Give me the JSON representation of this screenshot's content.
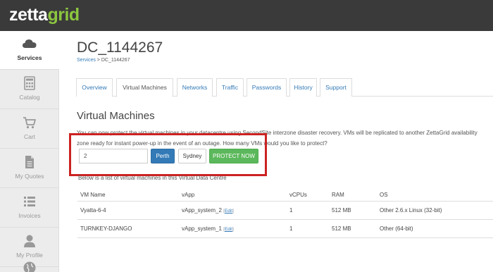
{
  "brand": {
    "part1": "zetta",
    "part2": "grid",
    "color_white": "#ffffff",
    "color_green": "#8cc63f"
  },
  "sidebar": {
    "items": [
      {
        "label": "Services",
        "icon": "cloud-icon",
        "active": true
      },
      {
        "label": "Catalog",
        "icon": "calculator-icon"
      },
      {
        "label": "Cart",
        "icon": "cart-icon"
      },
      {
        "label": "My Quotes",
        "icon": "document-icon"
      },
      {
        "label": "Invoices",
        "icon": "list-icon"
      },
      {
        "label": "My Profile",
        "icon": "user-icon"
      },
      {
        "label": "",
        "icon": "globe-icon"
      }
    ]
  },
  "page": {
    "title": "DC_1144267",
    "breadcrumb": {
      "root": "Services",
      "separator": ">",
      "current": "DC_1144267"
    }
  },
  "tabs": [
    "Overview",
    "Virtual Machines",
    "Networks",
    "Traffic",
    "Passwords",
    "History",
    "Support"
  ],
  "active_tab": "Virtual Machines",
  "section": {
    "title": "Virtual Machines",
    "description": "You can now protect the virtual machines in your datacentre using SecondSite interzone disaster recovery. VMs will be replicated to another ZettaGrid availability zone ready for instant power-up in the event of an outage. How many VMs would you like to protect?"
  },
  "protect_form": {
    "vm_count_value": "2",
    "perth_label": "Perth",
    "sydney_label": "Sydney",
    "protect_label": "PROTECT NOW"
  },
  "list_intro": "Below is a list of virtual machines in this Virtual Data Centre",
  "table": {
    "columns": [
      "VM Name",
      "vApp",
      "vCPUs",
      "RAM",
      "OS"
    ],
    "edit_label": "Edit",
    "rows": [
      {
        "name": "Vyatta-6-4",
        "vapp": "vApp_system_2",
        "vcpus": "1",
        "ram": "512 MB",
        "os": "Other 2.6.x Linux (32-bit)"
      },
      {
        "name": "TURNKEY-DJANGO",
        "vapp": "vApp_system_1",
        "vcpus": "1",
        "ram": "512 MB",
        "os": "Other (64-bit)"
      }
    ]
  },
  "colors": {
    "topbar": "#3a3a3a",
    "accent_blue": "#337ab7",
    "protect_green": "#5cb85c",
    "highlight_red": "#cc2222"
  }
}
